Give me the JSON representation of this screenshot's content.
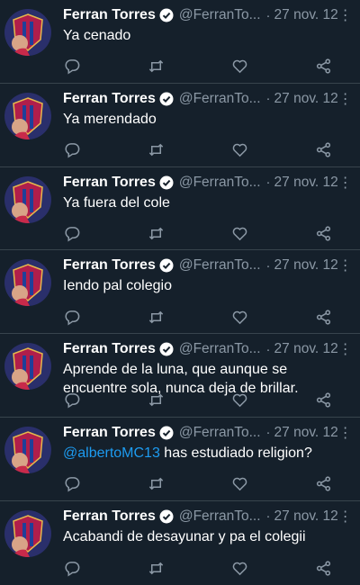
{
  "author": {
    "name": "Ferran Torres",
    "handle": "@FerranTo...",
    "separator": "·",
    "more": "⋮"
  },
  "icons": {
    "reply": "comment-icon",
    "retweet": "retweet-icon",
    "like": "heart-icon",
    "share": "share-icon",
    "verified": "verified-badge-icon"
  },
  "colors": {
    "background": "#15202b",
    "text": "#ffffff",
    "muted": "#8b98a5",
    "accent": "#1d9bf0",
    "divider": "#38444d"
  },
  "tweets": [
    {
      "date": "27 nov. 12",
      "text": "Ya cenado"
    },
    {
      "date": "27 nov. 12",
      "text": "Ya merendado"
    },
    {
      "date": "27 nov. 12",
      "text": "Ya fuera del cole"
    },
    {
      "date": "27 nov. 12",
      "text": "Iendo pal colegio"
    },
    {
      "date": "27 nov. 12",
      "text": "Aprende de la luna, que aunque se encuentre sola, nunca deja de brillar."
    },
    {
      "date": "27 nov. 12",
      "mention": "@albertoMC13",
      "text": " has estudiado religion?"
    },
    {
      "date": "27 nov. 12",
      "text": "Acabandi de desayunar y pa el colegii"
    }
  ]
}
